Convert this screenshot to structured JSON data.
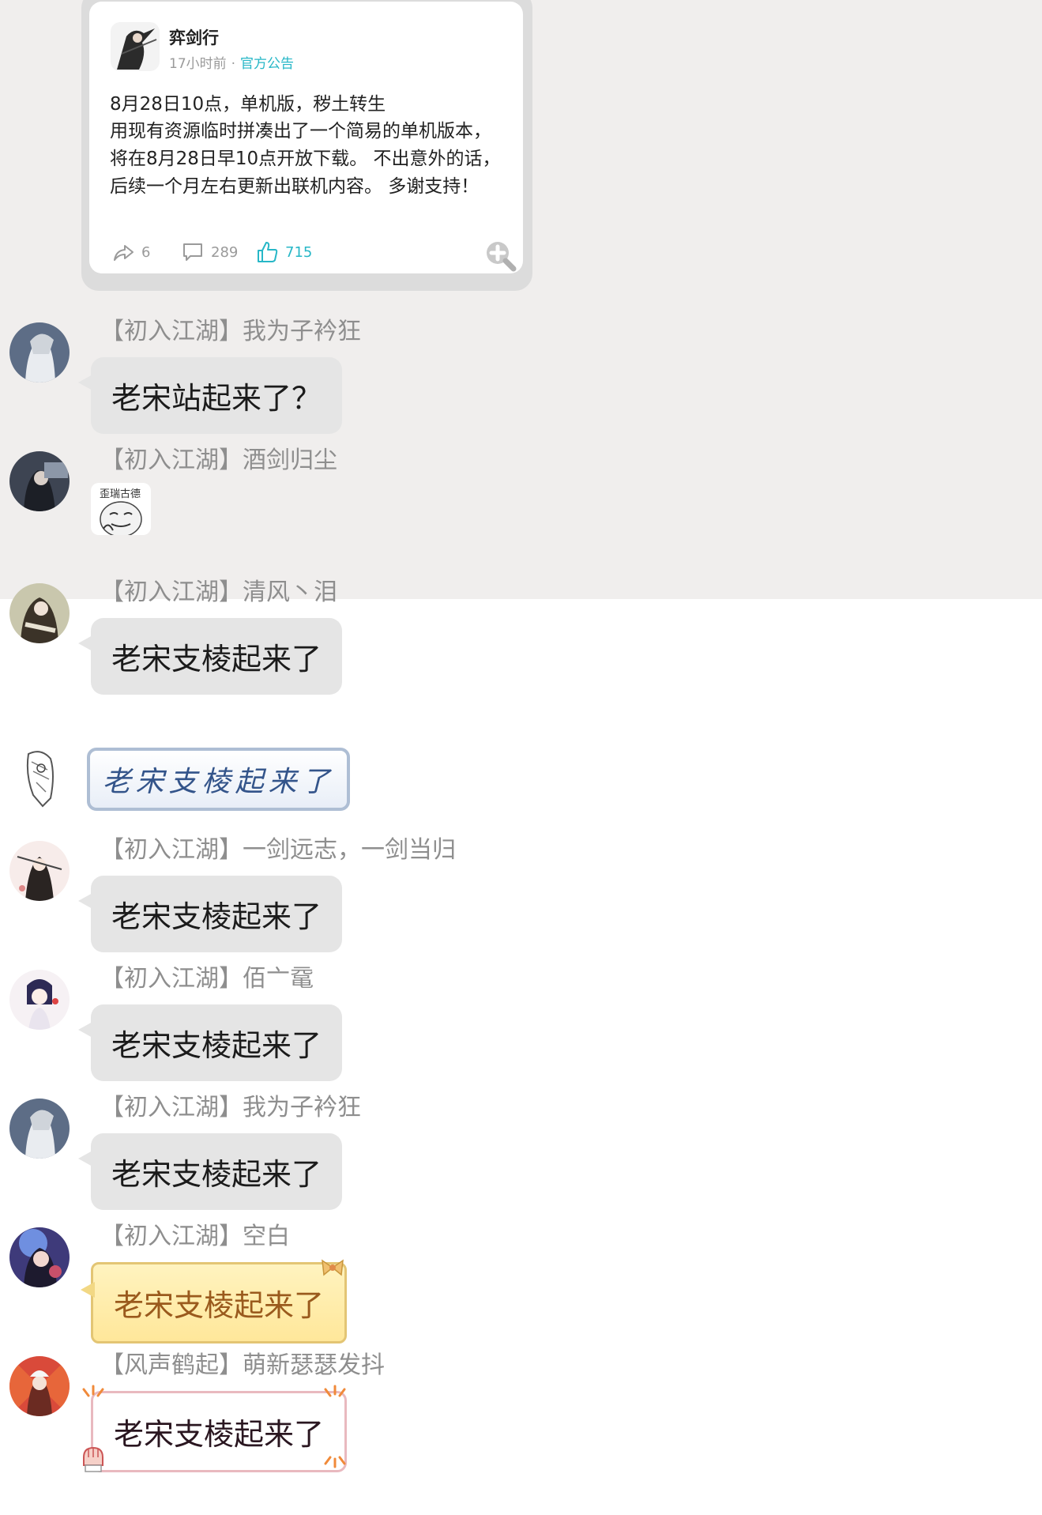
{
  "post": {
    "author": "弈剑行",
    "time": "17小时前",
    "separator": "·",
    "tag": "官方公告",
    "title": "8月28日10点，单机版，秽土转生",
    "body": "用现有资源临时拼凑出了一个简易的单机版本， 将在8月28日早10点开放下载。 不出意外的话，后续一个月左右更新出联机内容。 多谢支持！",
    "shares": "6",
    "comments": "289",
    "likes": "715"
  },
  "messages": [
    {
      "sender": "【初入江湖】我为子衿狂",
      "text": "老宋站起来了？"
    },
    {
      "sender": "【初入江湖】酒剑归尘",
      "sticker_text": "歪瑞古德"
    },
    {
      "sender": "【初入江湖】清风丶泪",
      "text": "老宋支棱起来了"
    },
    {
      "text": "老宋支棱起来了"
    },
    {
      "sender": "【初入江湖】一剑远志，一剑当归",
      "text": "老宋支棱起来了"
    },
    {
      "sender": "【初入江湖】佰亠鼋",
      "text": "老宋支棱起来了"
    },
    {
      "sender": "【初入江湖】我为子衿狂",
      "text": "老宋支棱起来了"
    },
    {
      "sender": "【初入江湖】空白",
      "text": "老宋支棱起来了"
    },
    {
      "sender": "【风声鹤起】萌新瑟瑟发抖",
      "text": "老宋支棱起来了"
    }
  ],
  "colors": {
    "top_background": "#f0eeed",
    "bubble": "#e5e5e5",
    "accent": "#27b7c7",
    "sender_text": "#8e8e8e"
  },
  "icons": [
    "share-icon",
    "comment-icon",
    "like-icon",
    "zoom-in-icon"
  ]
}
